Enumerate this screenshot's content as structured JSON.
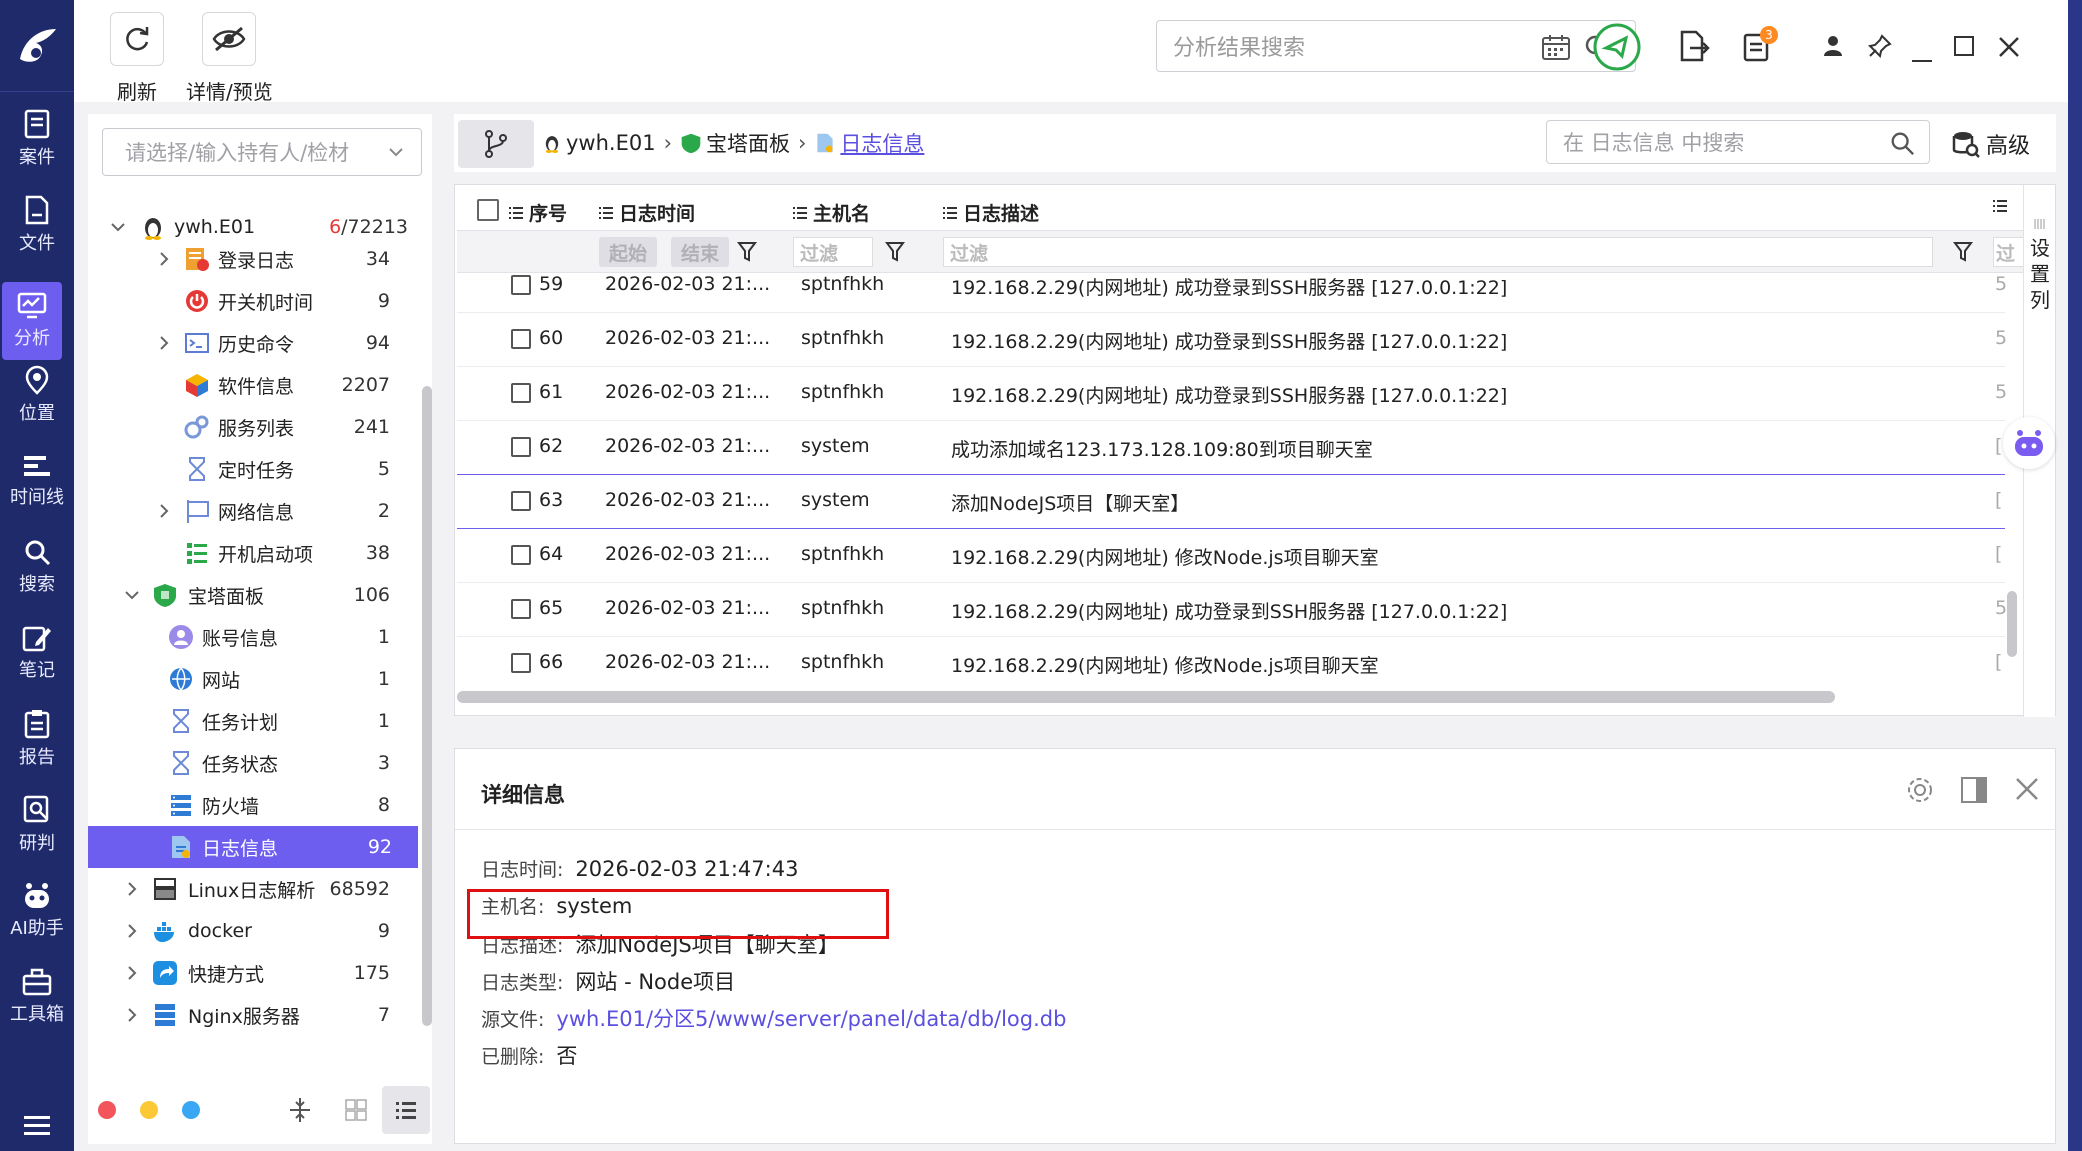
{
  "nav": {
    "items": [
      {
        "label": "案件",
        "icon": "case-icon"
      },
      {
        "label": "文件",
        "icon": "file-icon"
      },
      {
        "label": "分析",
        "icon": "analysis-icon"
      },
      {
        "label": "位置",
        "icon": "location-icon"
      },
      {
        "label": "时间线",
        "icon": "timeline-icon"
      },
      {
        "label": "搜索",
        "icon": "search-icon"
      },
      {
        "label": "笔记",
        "icon": "note-icon"
      },
      {
        "label": "报告",
        "icon": "report-icon"
      },
      {
        "label": "研判",
        "icon": "judge-icon"
      },
      {
        "label": "AI助手",
        "icon": "ai-bot-icon"
      },
      {
        "label": "工具箱",
        "icon": "toolbox-icon"
      }
    ],
    "active_index": 2
  },
  "toolbar": {
    "refresh_label": "刷新",
    "detail_preview_label": "详情/预览",
    "search_placeholder": "分析结果搜索",
    "notification_badge": "3"
  },
  "tree": {
    "select_placeholder": "请选择/输入持有人/检材",
    "root": {
      "label": "ywh.E01",
      "count_red": "6",
      "count_rest": "/72213"
    },
    "items": [
      {
        "label": "登录日志",
        "count": "34",
        "icon": "login-log-icon"
      },
      {
        "label": "开关机时间",
        "count": "9",
        "icon": "power-icon"
      },
      {
        "label": "历史命令",
        "count": "94",
        "icon": "terminal-icon"
      },
      {
        "label": "软件信息",
        "count": "2207",
        "icon": "software-icon"
      },
      {
        "label": "服务列表",
        "count": "241",
        "icon": "service-icon"
      },
      {
        "label": "定时任务",
        "count": "5",
        "icon": "hourglass-icon"
      },
      {
        "label": "网络信息",
        "count": "2",
        "icon": "network-icon"
      },
      {
        "label": "开机启动项",
        "count": "38",
        "icon": "startup-icon"
      },
      {
        "label": "宝塔面板",
        "count": "106",
        "icon": "bt-panel-icon"
      },
      {
        "label": "账号信息",
        "count": "1",
        "icon": "account-icon"
      },
      {
        "label": "网站",
        "count": "1",
        "icon": "website-icon"
      },
      {
        "label": "任务计划",
        "count": "1",
        "icon": "hourglass-icon"
      },
      {
        "label": "任务状态",
        "count": "3",
        "icon": "hourglass-icon"
      },
      {
        "label": "防火墙",
        "count": "8",
        "icon": "firewall-icon"
      },
      {
        "label": "日志信息",
        "count": "92",
        "icon": "log-info-icon"
      },
      {
        "label": "Linux日志解析",
        "count": "68592",
        "icon": "linux-log-icon"
      },
      {
        "label": "docker",
        "count": "9",
        "icon": "docker-icon"
      },
      {
        "label": "快捷方式",
        "count": "175",
        "icon": "shortcut-icon"
      },
      {
        "label": "Nginx服务器",
        "count": "7",
        "icon": "nginx-icon"
      }
    ]
  },
  "breadcrumb": {
    "root": "ywh.E01",
    "middle": "宝塔面板",
    "current": "日志信息",
    "search_placeholder": "在 日志信息 中搜索",
    "advanced_label": "高级"
  },
  "grid": {
    "headers": {
      "index": "序号",
      "time": "日志时间",
      "host": "主机名",
      "desc": "日志描述"
    },
    "filters": {
      "start": "起始",
      "end": "结束",
      "filter": "过滤",
      "filter2": "过滤",
      "filter3": "过"
    },
    "set_columns": [
      "设",
      "置",
      "列"
    ],
    "rows": [
      {
        "idx": "59",
        "time": "2026-02-03 21:...",
        "host": "sptnfhkh",
        "desc": "192.168.2.29(内网地址) 成功登录到SSH服务器 [127.0.0.1:22]",
        "tail": "5"
      },
      {
        "idx": "60",
        "time": "2026-02-03 21:...",
        "host": "sptnfhkh",
        "desc": "192.168.2.29(内网地址) 成功登录到SSH服务器 [127.0.0.1:22]",
        "tail": "5"
      },
      {
        "idx": "61",
        "time": "2026-02-03 21:...",
        "host": "sptnfhkh",
        "desc": "192.168.2.29(内网地址) 成功登录到SSH服务器 [127.0.0.1:22]",
        "tail": "5"
      },
      {
        "idx": "62",
        "time": "2026-02-03 21:...",
        "host": "system",
        "desc": "成功添加域名123.173.128.109:80到项目聊天室",
        "tail": "[",
        "hl": true
      },
      {
        "idx": "63",
        "time": "2026-02-03 21:...",
        "host": "system",
        "desc": "添加NodeJS项目【聊天室】",
        "tail": "[",
        "hl": false
      },
      {
        "idx": "64",
        "time": "2026-02-03 21:...",
        "host": "sptnfhkh",
        "desc": "192.168.2.29(内网地址) 修改Node.js项目聊天室",
        "tail": "["
      },
      {
        "idx": "65",
        "time": "2026-02-03 21:...",
        "host": "sptnfhkh",
        "desc": "192.168.2.29(内网地址) 成功登录到SSH服务器 [127.0.0.1:22]",
        "tail": "5"
      },
      {
        "idx": "66",
        "time": "2026-02-03 21:...",
        "host": "sptnfhkh",
        "desc": "192.168.2.29(内网地址) 修改Node.js项目聊天室",
        "tail": "["
      }
    ]
  },
  "detail": {
    "title": "详细信息",
    "fields": [
      {
        "key": "日志时间:",
        "value": "2026-02-03 21:47:43"
      },
      {
        "key": "主机名:",
        "value": "system"
      },
      {
        "key": "日志描述:",
        "value": "添加NodeJS项目【聊天室】"
      },
      {
        "key": "日志类型:",
        "value": "网站 - Node项目"
      },
      {
        "key": "源文件:",
        "value": "ywh.E01/分区5/www/server/panel/data/db/log.db"
      },
      {
        "key": "已删除:",
        "value": "否"
      }
    ]
  },
  "colors": {
    "nav_bg": "#1f2a6b",
    "accent": "#6d5ef0",
    "link": "#5b4fe0",
    "highlight_box": "#e01010",
    "shield_green": "#2aa84a"
  }
}
